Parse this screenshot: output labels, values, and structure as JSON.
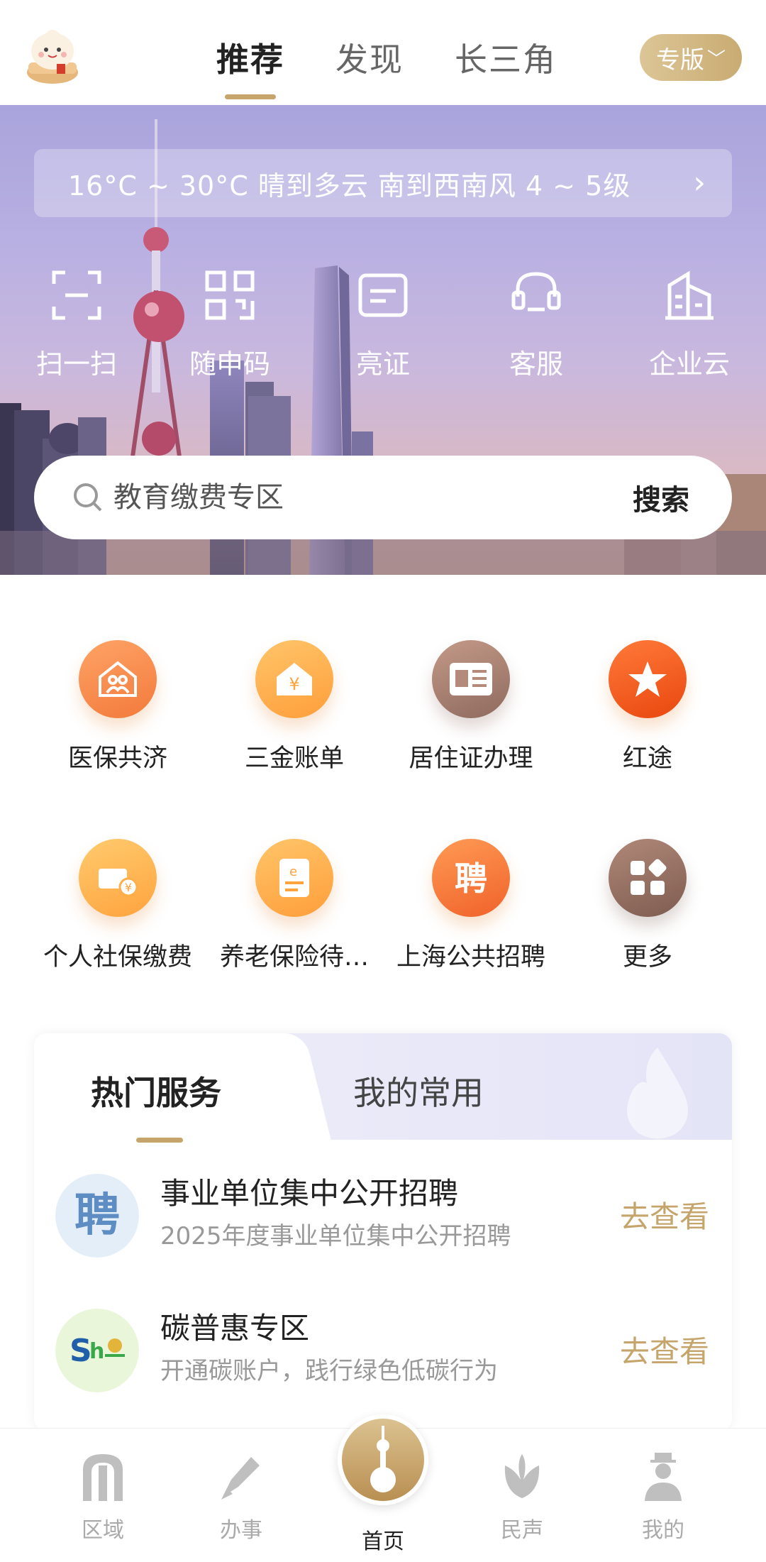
{
  "header": {
    "tabs": [
      {
        "label": "推荐",
        "active": true
      },
      {
        "label": "发现",
        "active": false
      },
      {
        "label": "长三角",
        "active": false
      }
    ],
    "edition_label": "专版",
    "accent_color": "#c6a56c"
  },
  "hero": {
    "weather_text": "16°C ~ 30°C  晴到多云  南到西南风  4 ~ 5级",
    "quick_actions": [
      {
        "label": "扫一扫",
        "icon": "scan-icon"
      },
      {
        "label": "随申码",
        "icon": "qr-code-icon"
      },
      {
        "label": "亮证",
        "icon": "id-card-icon"
      },
      {
        "label": "客服",
        "icon": "headset-icon"
      },
      {
        "label": "企业云",
        "icon": "building-icon"
      }
    ],
    "search": {
      "placeholder": "教育缴费专区",
      "button": "搜索"
    }
  },
  "services": [
    {
      "label": "医保共济",
      "icon": "family-house-icon"
    },
    {
      "label": "三金账单",
      "icon": "yuan-house-icon"
    },
    {
      "label": "居住证办理",
      "icon": "residence-card-icon"
    },
    {
      "label": "红途",
      "icon": "red-star-icon"
    },
    {
      "label": "个人社保缴费",
      "icon": "social-insurance-icon"
    },
    {
      "label": "养老保险待…",
      "icon": "pension-doc-icon"
    },
    {
      "label": "上海公共招聘",
      "icon": "recruit-icon"
    },
    {
      "label": "更多",
      "icon": "more-grid-icon"
    }
  ],
  "hot": {
    "tabs": [
      {
        "label": "热门服务",
        "active": true
      },
      {
        "label": "我的常用",
        "active": false
      }
    ],
    "items": [
      {
        "title": "事业单位集中公开招聘",
        "subtitle": "2025年度事业单位集中公开招聘",
        "action": "去查看",
        "logo": "recruit-logo"
      },
      {
        "title": "碳普惠专区",
        "subtitle": "开通碳账户，践行绿色低碳行为",
        "action": "去查看",
        "logo": "carbon-logo"
      }
    ]
  },
  "bottom_nav": [
    {
      "label": "区域",
      "icon": "region-icon",
      "active": false
    },
    {
      "label": "办事",
      "icon": "pen-icon",
      "active": false
    },
    {
      "label": "首页",
      "icon": "home-tower-icon",
      "active": true
    },
    {
      "label": "民声",
      "icon": "flower-icon",
      "active": false
    },
    {
      "label": "我的",
      "icon": "person-icon",
      "active": false
    }
  ]
}
